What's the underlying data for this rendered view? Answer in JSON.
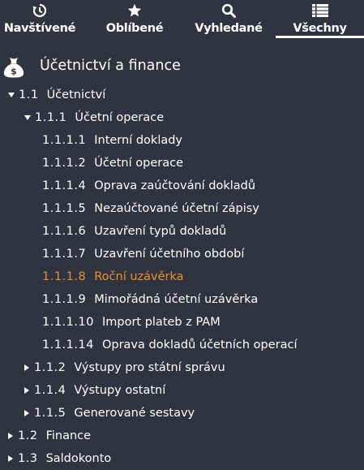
{
  "tabs": [
    {
      "label": "Navštívené",
      "icon": "history-icon",
      "active": false
    },
    {
      "label": "Oblíbené",
      "icon": "star-icon",
      "active": false
    },
    {
      "label": "Vyhledané",
      "icon": "search-icon",
      "active": false
    },
    {
      "label": "Všechny",
      "icon": "list-icon",
      "active": true
    }
  ],
  "module": {
    "title": "Účetnictví a finance",
    "icon": "money-bag-icon"
  },
  "tree": [
    {
      "num": "1.1",
      "label": "Účetnictví",
      "expanded": true
    },
    {
      "num": "1.1.1",
      "label": "Účetní operace",
      "expanded": true
    },
    {
      "num": "1.1.1.1",
      "label": "Interní doklady"
    },
    {
      "num": "1.1.1.2",
      "label": "Účetní operace"
    },
    {
      "num": "1.1.1.4",
      "label": "Oprava zaúčtování dokladů"
    },
    {
      "num": "1.1.1.5",
      "label": "Nezaúčtované účetní zápisy"
    },
    {
      "num": "1.1.1.6",
      "label": "Uzavření typů dokladů"
    },
    {
      "num": "1.1.1.7",
      "label": "Uzavření účetního období"
    },
    {
      "num": "1.1.1.8",
      "label": "Roční uzávěrka",
      "highlighted": true
    },
    {
      "num": "1.1.1.9",
      "label": "Mimořádná účetní uzávěrka"
    },
    {
      "num": "1.1.1.10",
      "label": "Import plateb z PAM"
    },
    {
      "num": "1.1.1.14",
      "label": "Oprava dokladů účetních operací"
    },
    {
      "num": "1.1.2",
      "label": "Výstupy pro státní správu",
      "expanded": false
    },
    {
      "num": "1.1.4",
      "label": "Výstupy ostatní",
      "expanded": false
    },
    {
      "num": "1.1.5",
      "label": "Generované sestavy",
      "expanded": false
    },
    {
      "num": "1.2",
      "label": "Finance",
      "expanded": false
    },
    {
      "num": "1.3",
      "label": "Saldokonto",
      "expanded": false
    }
  ],
  "colors": {
    "background": "#2e3440",
    "text": "#ffffff",
    "highlight": "#f28c28"
  }
}
